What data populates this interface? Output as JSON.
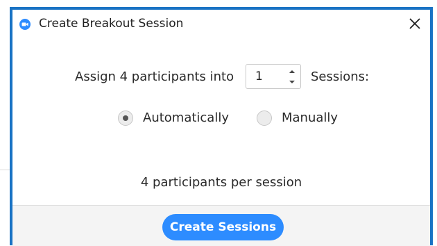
{
  "window": {
    "title": "Create Breakout Session",
    "icon": "zoom-app-icon",
    "close_icon": "close-icon"
  },
  "assign": {
    "prefix": "Assign 4 participants into",
    "session_count": "1",
    "suffix": "Sessions:"
  },
  "assignment_mode": {
    "selected": "Automatically",
    "options": [
      "Automatically",
      "Manually"
    ]
  },
  "summary": "4 participants per session",
  "footer": {
    "create_label": "Create Sessions"
  },
  "colors": {
    "window_border": "#1a73c4",
    "primary_button": "#2d8cff",
    "footer_bg": "#f4f4f4"
  }
}
